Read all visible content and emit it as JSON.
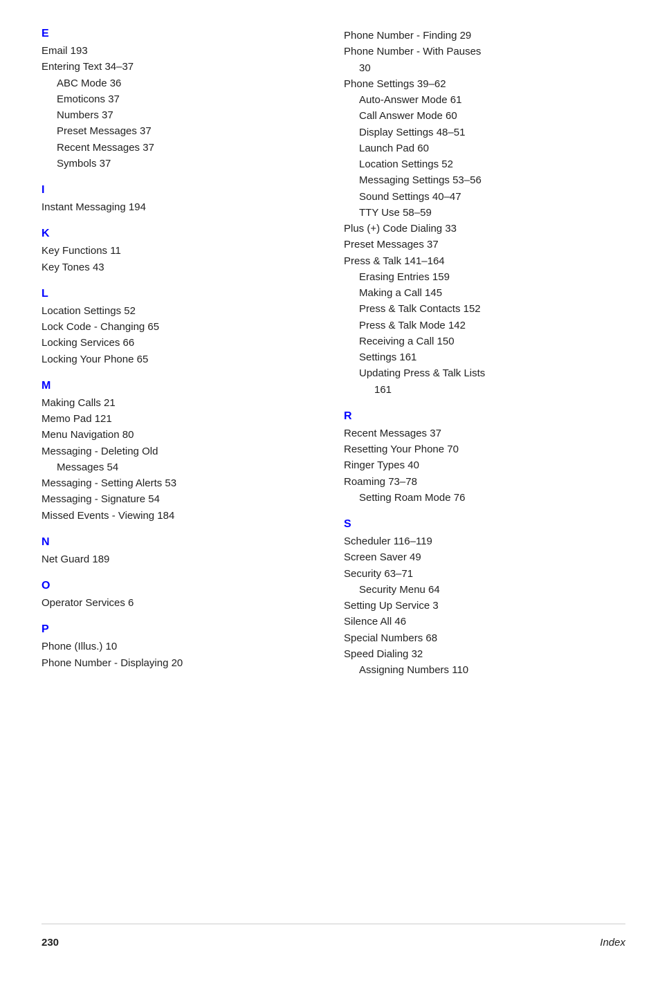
{
  "left_col": {
    "sections": [
      {
        "letter": "E",
        "entries": [
          {
            "text": "Email  193",
            "level": 0
          },
          {
            "text": "Entering Text  34–37",
            "level": 0
          },
          {
            "text": "ABC Mode  36",
            "level": 1
          },
          {
            "text": "Emoticons  37",
            "level": 1
          },
          {
            "text": "Numbers  37",
            "level": 1
          },
          {
            "text": "Preset Messages  37",
            "level": 1
          },
          {
            "text": "Recent Messages  37",
            "level": 1
          },
          {
            "text": "Symbols  37",
            "level": 1
          }
        ]
      },
      {
        "letter": "I",
        "entries": [
          {
            "text": "Instant Messaging  194",
            "level": 0
          }
        ]
      },
      {
        "letter": "K",
        "entries": [
          {
            "text": "Key Functions  11",
            "level": 0
          },
          {
            "text": "Key Tones  43",
            "level": 0
          }
        ]
      },
      {
        "letter": "L",
        "entries": [
          {
            "text": "Location Settings  52",
            "level": 0
          },
          {
            "text": "Lock Code - Changing  65",
            "level": 0
          },
          {
            "text": "Locking Services  66",
            "level": 0
          },
          {
            "text": "Locking Your Phone  65",
            "level": 0
          }
        ]
      },
      {
        "letter": "M",
        "entries": [
          {
            "text": "Making Calls  21",
            "level": 0
          },
          {
            "text": "Memo Pad  121",
            "level": 0
          },
          {
            "text": "Menu Navigation  80",
            "level": 0
          },
          {
            "text": "Messaging - Deleting Old",
            "level": 0
          },
          {
            "text": "Messages  54",
            "level": 1
          },
          {
            "text": "Messaging - Setting Alerts  53",
            "level": 0
          },
          {
            "text": "Messaging - Signature  54",
            "level": 0
          },
          {
            "text": "Missed Events - Viewing  184",
            "level": 0
          }
        ]
      },
      {
        "letter": "N",
        "entries": [
          {
            "text": "Net Guard  189",
            "level": 0
          }
        ]
      },
      {
        "letter": "O",
        "entries": [
          {
            "text": "Operator Services  6",
            "level": 0
          }
        ]
      },
      {
        "letter": "P",
        "entries": [
          {
            "text": "Phone (Illus.)  10",
            "level": 0
          },
          {
            "text": "Phone Number - Displaying  20",
            "level": 0
          }
        ]
      }
    ]
  },
  "right_col": {
    "sections": [
      {
        "letter": null,
        "entries": [
          {
            "text": "Phone Number - Finding  29",
            "level": 0
          },
          {
            "text": "Phone Number - With Pauses",
            "level": 0
          },
          {
            "text": "30",
            "level": 1
          },
          {
            "text": "Phone Settings  39–62",
            "level": 0
          },
          {
            "text": "Auto-Answer Mode  61",
            "level": 1
          },
          {
            "text": "Call Answer Mode  60",
            "level": 1
          },
          {
            "text": "Display Settings  48–51",
            "level": 1
          },
          {
            "text": "Launch Pad  60",
            "level": 1
          },
          {
            "text": "Location Settings  52",
            "level": 1
          },
          {
            "text": "Messaging Settings  53–56",
            "level": 1
          },
          {
            "text": "Sound Settings  40–47",
            "level": 1
          },
          {
            "text": "TTY Use  58–59",
            "level": 1
          },
          {
            "text": "Plus (+) Code Dialing  33",
            "level": 0
          },
          {
            "text": "Preset Messages  37",
            "level": 0
          },
          {
            "text": "Press & Talk  141–164",
            "level": 0
          },
          {
            "text": "Erasing Entries  159",
            "level": 1
          },
          {
            "text": "Making a Call  145",
            "level": 1
          },
          {
            "text": "Press & Talk Contacts  152",
            "level": 1
          },
          {
            "text": "Press & Talk Mode  142",
            "level": 1
          },
          {
            "text": "Receiving a Call  150",
            "level": 1
          },
          {
            "text": "Settings  161",
            "level": 1
          },
          {
            "text": "Updating Press & Talk Lists",
            "level": 1
          },
          {
            "text": "161",
            "level": 2
          }
        ]
      },
      {
        "letter": "R",
        "entries": [
          {
            "text": "Recent Messages  37",
            "level": 0
          },
          {
            "text": "Resetting Your Phone  70",
            "level": 0
          },
          {
            "text": "Ringer Types  40",
            "level": 0
          },
          {
            "text": "Roaming  73–78",
            "level": 0
          },
          {
            "text": "Setting Roam Mode  76",
            "level": 1
          }
        ]
      },
      {
        "letter": "S",
        "entries": [
          {
            "text": "Scheduler  116–119",
            "level": 0
          },
          {
            "text": "Screen Saver  49",
            "level": 0
          },
          {
            "text": "Security  63–71",
            "level": 0
          },
          {
            "text": "Security Menu  64",
            "level": 1
          },
          {
            "text": "Setting Up Service  3",
            "level": 0
          },
          {
            "text": "Silence All  46",
            "level": 0
          },
          {
            "text": "Special Numbers  68",
            "level": 0
          },
          {
            "text": "Speed Dialing  32",
            "level": 0
          },
          {
            "text": "Assigning Numbers  110",
            "level": 1
          }
        ]
      }
    ]
  },
  "footer": {
    "page": "230",
    "label": "Index"
  }
}
